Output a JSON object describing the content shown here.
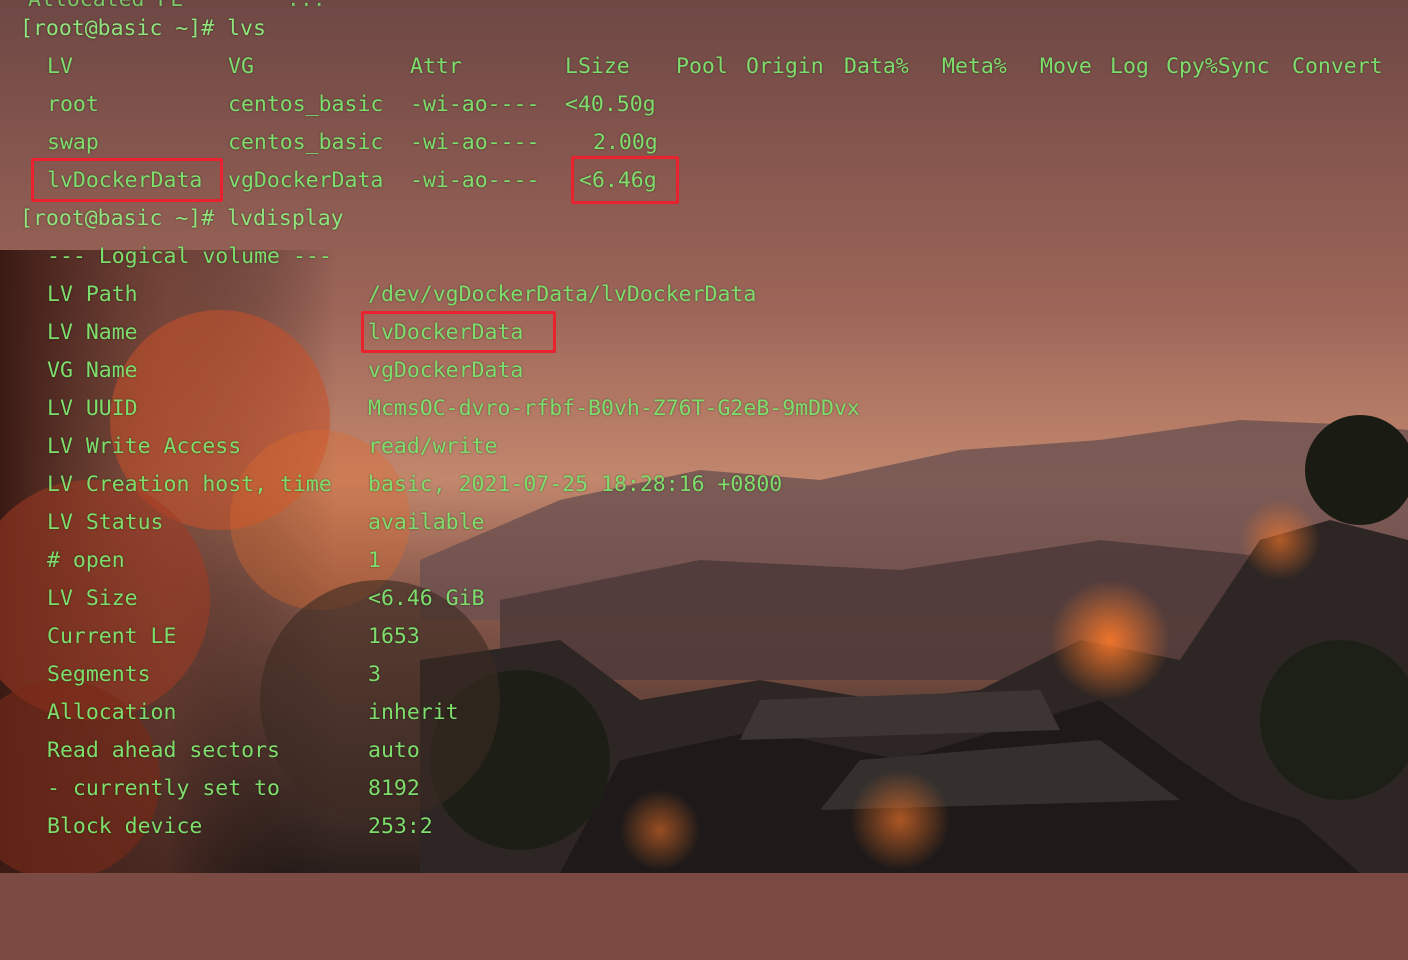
{
  "colors": {
    "text": "#7dde6c",
    "highlight": "#e8222e"
  },
  "top_fragment": "Allocated PE        ...",
  "prompt1": "[root@basic ~]# lvs",
  "lvs": {
    "headers": [
      "LV",
      "VG",
      "Attr",
      "LSize",
      "Pool",
      "Origin",
      "Data%",
      "Meta%",
      "Move",
      "Log",
      "Cpy%Sync",
      "Convert"
    ],
    "rows": [
      {
        "lv": "root",
        "vg": "centos_basic",
        "attr": "-wi-ao----",
        "lsize": "<40.50g"
      },
      {
        "lv": "swap",
        "vg": "centos_basic",
        "attr": "-wi-ao----",
        "lsize": "2.00g"
      },
      {
        "lv": "lvDockerData",
        "vg": "vgDockerData",
        "attr": "-wi-ao----",
        "lsize": "<6.46g"
      }
    ]
  },
  "prompt2": "[root@basic ~]# lvdisplay",
  "lvdisplay": {
    "section": "--- Logical volume ---",
    "fields": [
      {
        "key": "LV Path",
        "value": "/dev/vgDockerData/lvDockerData"
      },
      {
        "key": "LV Name",
        "value": "lvDockerData"
      },
      {
        "key": "VG Name",
        "value": "vgDockerData"
      },
      {
        "key": "LV UUID",
        "value": "McmsOC-dvro-rfbf-B0vh-Z76T-G2eB-9mDDvx"
      },
      {
        "key": "LV Write Access",
        "value": "read/write"
      },
      {
        "key": "LV Creation host, time",
        "value": "basic, 2021-07-25 18:28:16 +0800"
      },
      {
        "key": "LV Status",
        "value": "available"
      },
      {
        "key": "# open",
        "value": "1"
      },
      {
        "key": "LV Size",
        "value": "<6.46 GiB"
      },
      {
        "key": "Current LE",
        "value": "1653"
      },
      {
        "key": "Segments",
        "value": "3"
      },
      {
        "key": "Allocation",
        "value": "inherit"
      },
      {
        "key": "Read ahead sectors",
        "value": "auto"
      },
      {
        "key": "- currently set to",
        "value": "8192"
      },
      {
        "key": "Block device",
        "value": "253:2"
      }
    ]
  }
}
